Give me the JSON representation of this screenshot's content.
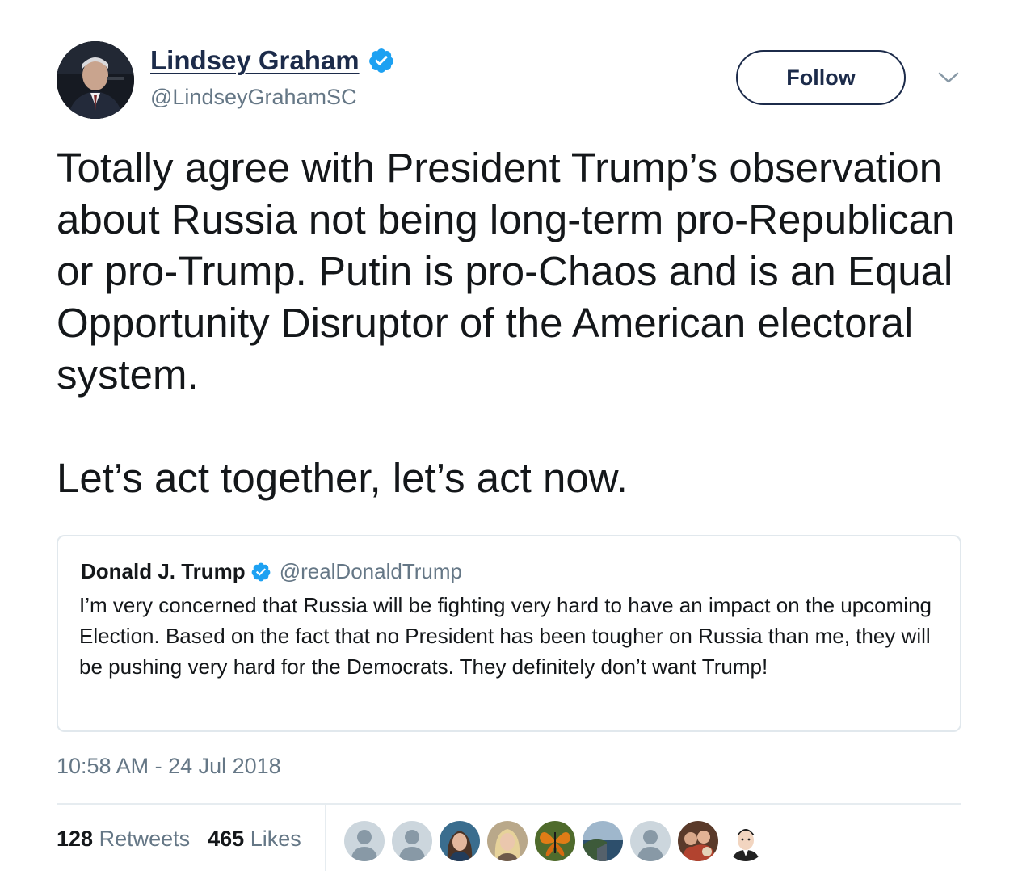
{
  "author": {
    "name": "Lindsey Graham",
    "handle": "@LindseyGrahamSC",
    "verified": true
  },
  "follow_label": "Follow",
  "tweet": {
    "text": "Totally agree with President Trump’s observation about Russia not being long-term pro-Republican or pro-Trump. Putin is pro-Chaos and is an Equal Opportunity Disruptor of the American electoral system.\n\nLet’s act together, let’s act now."
  },
  "quoted": {
    "name": "Donald J. Trump",
    "handle": "@realDonaldTrump",
    "verified": true,
    "text": "I’m very concerned that Russia will be fighting very hard to have an impact on the upcoming Election. Based on the fact that no President has been tougher on Russia than me, they will be pushing very hard for the Democrats. They definitely don’t want Trump!"
  },
  "timestamp": "10:58 AM - 24 Jul 2018",
  "stats": {
    "retweets_count": "128",
    "retweets_label": "Retweets",
    "likes_count": "465",
    "likes_label": "Likes"
  },
  "likers": [
    {
      "kind": "default-avatar"
    },
    {
      "kind": "default-avatar"
    },
    {
      "kind": "photo-avatar"
    },
    {
      "kind": "photo-avatar"
    },
    {
      "kind": "butterfly-avatar"
    },
    {
      "kind": "landscape-avatar"
    },
    {
      "kind": "default-avatar"
    },
    {
      "kind": "photo-avatar"
    },
    {
      "kind": "cartoon-avatar"
    }
  ],
  "colors": {
    "verified_blue": "#1da1f2",
    "name_navy": "#1c2b4a",
    "secondary_gray": "#657786",
    "border": "#e1e8ed"
  }
}
